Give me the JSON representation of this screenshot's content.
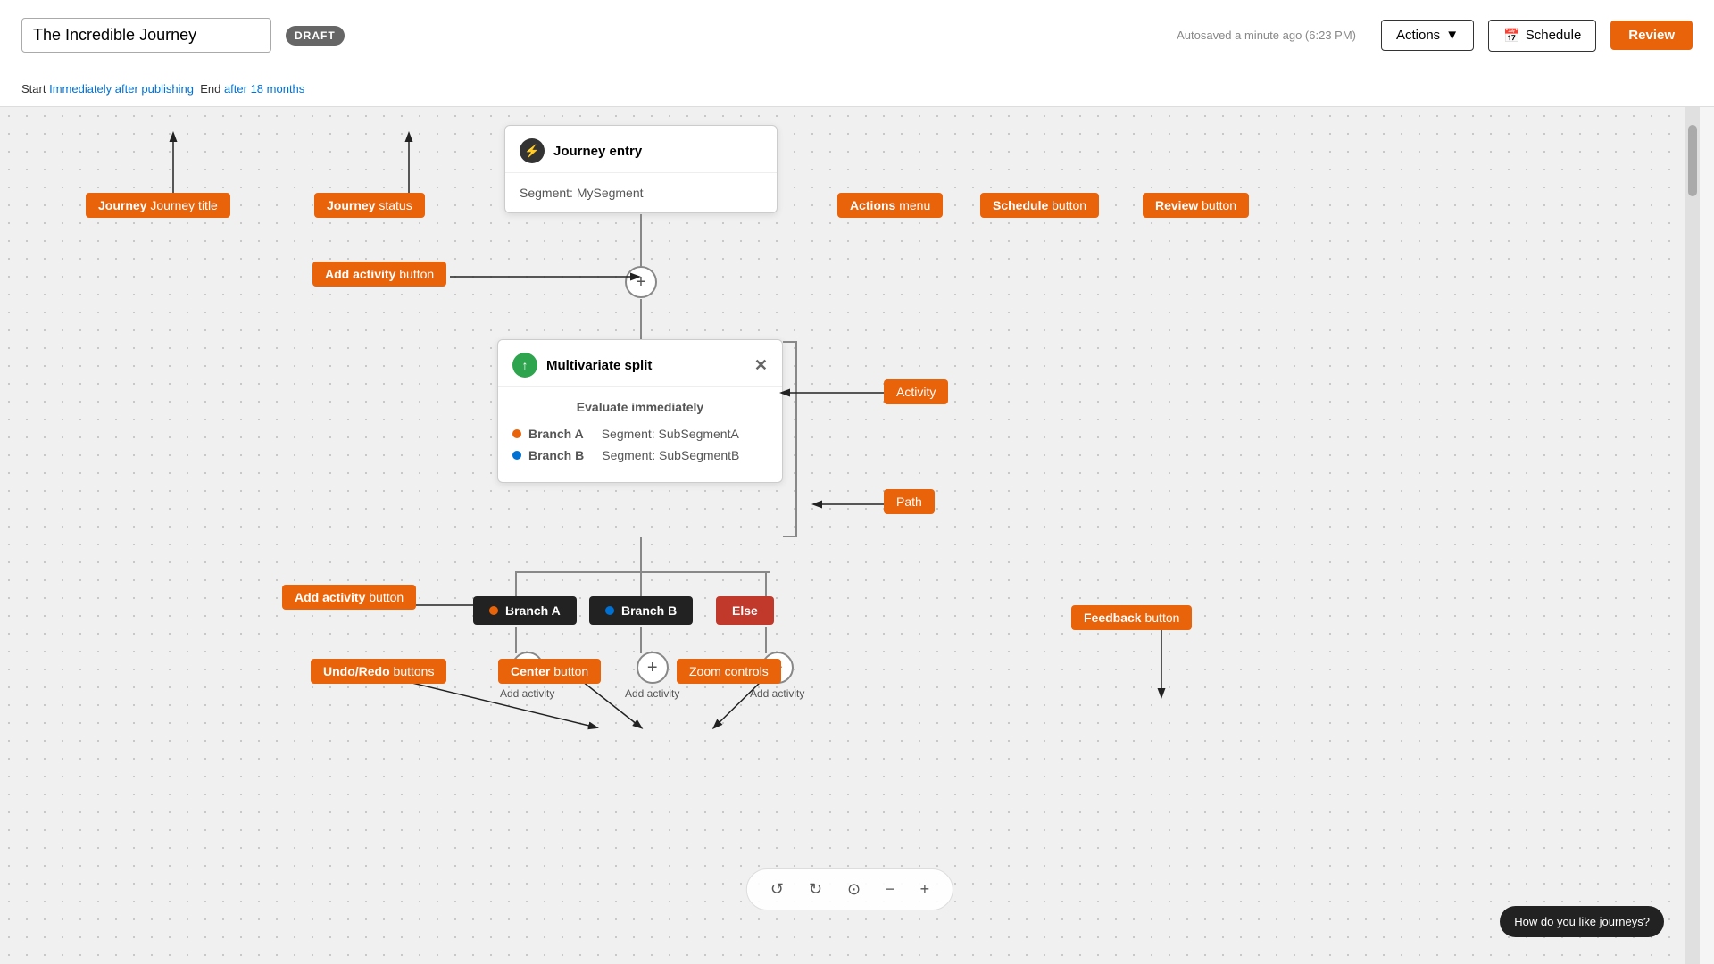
{
  "header": {
    "title": "The Incredible Journey",
    "draft_label": "DRAFT",
    "autosave": "Autosaved a minute ago (6:23 PM)",
    "actions_label": "Actions",
    "schedule_label": "Schedule",
    "review_label": "Review"
  },
  "subheader": {
    "start_label": "Start",
    "start_link": "Immediately after publishing",
    "end_label": "End",
    "end_link": "after 18 months"
  },
  "annotations": {
    "journey_title": "Journey title",
    "journey_status": "Journey status",
    "actions_menu": "Actions menu",
    "schedule_button": "Schedule button",
    "review_button": "Review button",
    "add_activity_top": "Add activity button",
    "activity": "Activity",
    "path": "Path",
    "add_activity_bottom": "Add activity button",
    "undo_redo": "Undo/Redo buttons",
    "center_button": "Center button",
    "zoom_controls": "Zoom controls",
    "feedback_button": "Feedback button"
  },
  "journey_entry_card": {
    "icon": "⚡",
    "title": "Journey entry",
    "segment": "Segment: MySegment"
  },
  "multivariate_card": {
    "icon": "↑",
    "title": "Multivariate split",
    "evaluate": "Evaluate immediately",
    "branch_a_label": "Branch A",
    "branch_a_segment": "Segment: SubSegmentA",
    "branch_b_label": "Branch B",
    "branch_b_segment": "Segment: SubSegmentB"
  },
  "paths": {
    "branch_a": "Branch A",
    "branch_b": "Branch B",
    "else": "Else"
  },
  "add_activity_labels": [
    "Add activity",
    "Add activity",
    "Add activity"
  ],
  "feedback": {
    "text": "How do you like journeys?"
  },
  "toolbar": {
    "undo": "↺",
    "redo": "↻",
    "center": "⊙",
    "zoom_out": "−",
    "zoom_in": "+"
  }
}
